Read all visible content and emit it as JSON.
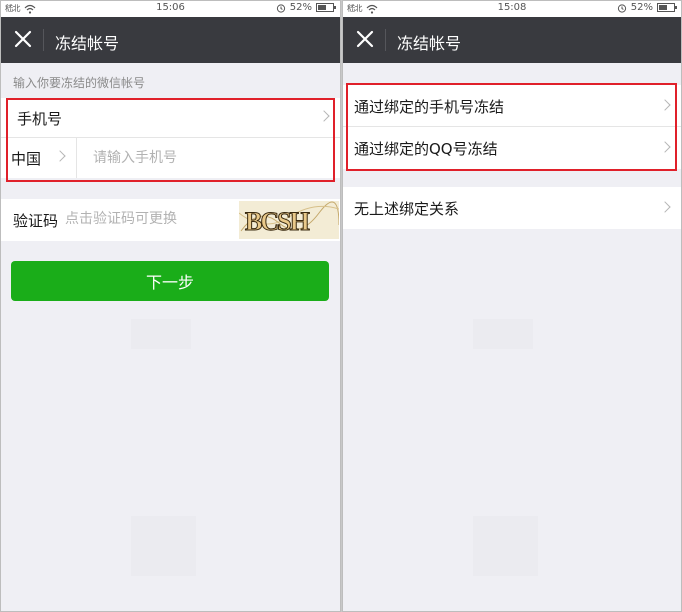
{
  "left": {
    "status_time": "15:06",
    "battery": "52%",
    "carrier": "嵇北",
    "battery_level": 0.52,
    "nav_title": "冻结帐号",
    "hint": "输入你要冻结的微信帐号",
    "phone_row_label": "手机号",
    "country_label": "中国",
    "phone_placeholder": "请输入手机号",
    "code_label": "验证码",
    "code_placeholder": "点击验证码可更换",
    "captcha_text": "BCSH",
    "next_label": "下一步"
  },
  "right": {
    "status_time": "15:08",
    "battery": "52%",
    "carrier": "嵇北",
    "battery_level": 0.52,
    "nav_title": "冻结帐号",
    "options": [
      {
        "label": "通过绑定的手机号冻结"
      },
      {
        "label": "通过绑定的QQ号冻结"
      }
    ],
    "other_option": "无上述绑定关系"
  },
  "colors": {
    "nav_bg": "#393a3f",
    "primary_green": "#1aad19",
    "highlight_red": "#e0202a",
    "page_bg": "#efeff4"
  }
}
